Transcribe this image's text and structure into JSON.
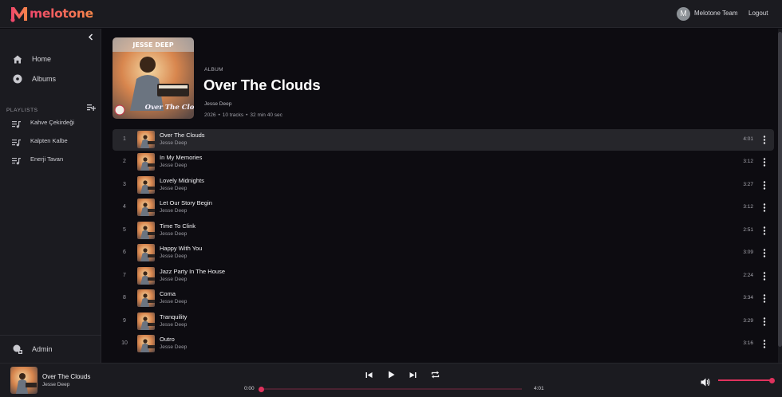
{
  "app": {
    "brand": "melotone",
    "accent": "#e0325d"
  },
  "header": {
    "user_initial": "M",
    "user_name": "Melotone Team",
    "logout_label": "Logout"
  },
  "sidebar": {
    "nav": [
      {
        "label": "Home",
        "icon": "home-icon"
      },
      {
        "label": "Albums",
        "icon": "disc-icon"
      }
    ],
    "playlists_heading": "PLAYLISTS",
    "playlists": [
      {
        "label": "Kahve Çekirdeği"
      },
      {
        "label": "Kalpten Kalbe"
      },
      {
        "label": "Enerji Tavan"
      }
    ],
    "admin_label": "Admin"
  },
  "album": {
    "type_label": "ALBUM",
    "title": "Over The Clouds",
    "artist": "Jesse Deep",
    "year": "2026",
    "track_count": "10 tracks",
    "duration": "32 min 40 sec",
    "sep": "•",
    "cover_text_top": "JESSE DEEP",
    "cover_text_bottom": "Over The Clouds"
  },
  "tracks": [
    {
      "num": "1",
      "title": "Over The Clouds",
      "artist": "Jesse Deep",
      "duration": "4:01",
      "active": true
    },
    {
      "num": "2",
      "title": "In My Memories",
      "artist": "Jesse Deep",
      "duration": "3:12"
    },
    {
      "num": "3",
      "title": "Lovely Midnights",
      "artist": "Jesse Deep",
      "duration": "3:27"
    },
    {
      "num": "4",
      "title": "Let Our Story Begin",
      "artist": "Jesse Deep",
      "duration": "3:12"
    },
    {
      "num": "5",
      "title": "Time To Clink",
      "artist": "Jesse Deep",
      "duration": "2:51"
    },
    {
      "num": "6",
      "title": "Happy With You",
      "artist": "Jesse Deep",
      "duration": "3:09"
    },
    {
      "num": "7",
      "title": "Jazz Party In The House",
      "artist": "Jesse Deep",
      "duration": "2:24"
    },
    {
      "num": "8",
      "title": "Coma",
      "artist": "Jesse Deep",
      "duration": "3:34"
    },
    {
      "num": "9",
      "title": "Tranquility",
      "artist": "Jesse Deep",
      "duration": "3:29"
    },
    {
      "num": "10",
      "title": "Outro",
      "artist": "Jesse Deep",
      "duration": "3:16"
    }
  ],
  "player": {
    "title": "Over The Clouds",
    "artist": "Jesse Deep",
    "elapsed": "0:00",
    "total": "4:01",
    "progress_fraction": 0,
    "volume_fraction": 1
  }
}
